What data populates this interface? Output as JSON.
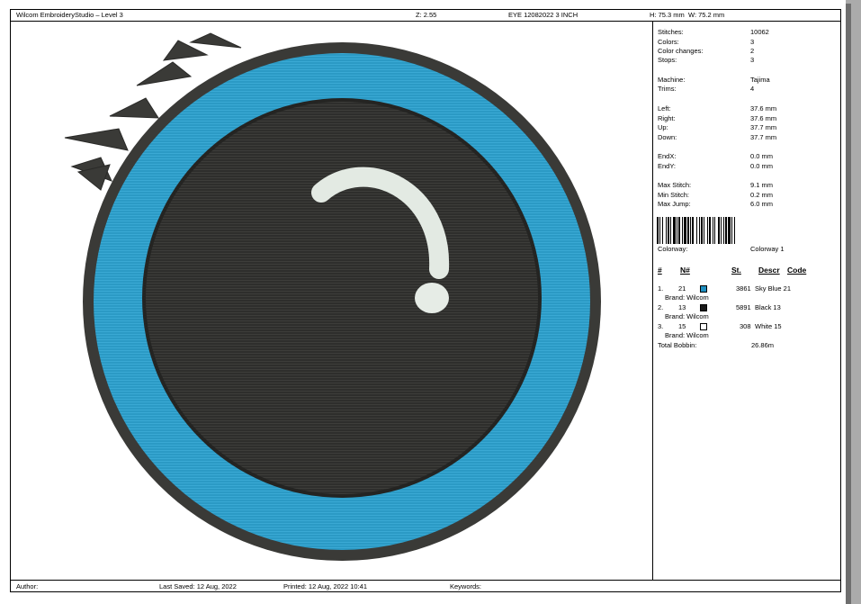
{
  "header": {
    "app_title": "Wilcom EmbroideryStudio – Level 3",
    "zoom": "Z: 2.55",
    "design_name": "EYE 12082022 3 INCH",
    "height": "H: 75.3 mm",
    "width": "W: 75.2 mm"
  },
  "info": [
    {
      "label": "Stitches:",
      "value": "10062"
    },
    {
      "label": "Colors:",
      "value": "3"
    },
    {
      "label": "Color changes:",
      "value": "2"
    },
    {
      "label": "Stops:",
      "value": "3"
    },
    {
      "label": "Machine:",
      "value": "Tajima"
    },
    {
      "label": "Trims:",
      "value": "4"
    },
    {
      "label": "Left:",
      "value": "37.6 mm"
    },
    {
      "label": "Right:",
      "value": "37.6 mm"
    },
    {
      "label": "Up:",
      "value": "37.7 mm"
    },
    {
      "label": "Down:",
      "value": "37.7 mm"
    },
    {
      "label": "EndX:",
      "value": "0.0 mm"
    },
    {
      "label": "EndY:",
      "value": "0.0 mm"
    },
    {
      "label": "Max Stitch:",
      "value": "9.1 mm"
    },
    {
      "label": "Min Stitch:",
      "value": "0.2 mm"
    },
    {
      "label": "Max Jump:",
      "value": "6.0 mm"
    }
  ],
  "colorway": {
    "label": "Colorway:",
    "value": "Colorway 1"
  },
  "table": {
    "headers": {
      "index": "#",
      "number": "N#",
      "stitches": "St.",
      "descr": "Descr",
      "code": "Code"
    },
    "rows": [
      {
        "index": "1.",
        "number": "21",
        "color": "#1f8fc0",
        "stitches": "3861",
        "descr": "Sky Blue 21",
        "brand": "Brand: Wilcom"
      },
      {
        "index": "2.",
        "number": "13",
        "color": "#1a1a1a",
        "stitches": "5891",
        "descr": "Black 13",
        "brand": "Brand: Wilcom"
      },
      {
        "index": "3.",
        "number": "15",
        "color": "#ffffff",
        "stitches": "308",
        "descr": "White 15",
        "brand": "Brand: Wilcom"
      }
    ],
    "total_label": "Total Bobbin:",
    "total_value": "26.86m"
  },
  "footer": {
    "author": "Author:",
    "last_saved": "Last Saved: 12 Aug, 2022",
    "printed": "Printed: 12 Aug, 2022 10:41",
    "keywords": "Keywords:"
  },
  "colors": {
    "outline": "#3a3a37",
    "ring": "#2b9ac5",
    "pupil": "#2e2e2c",
    "highlight": "#e6ece6"
  }
}
